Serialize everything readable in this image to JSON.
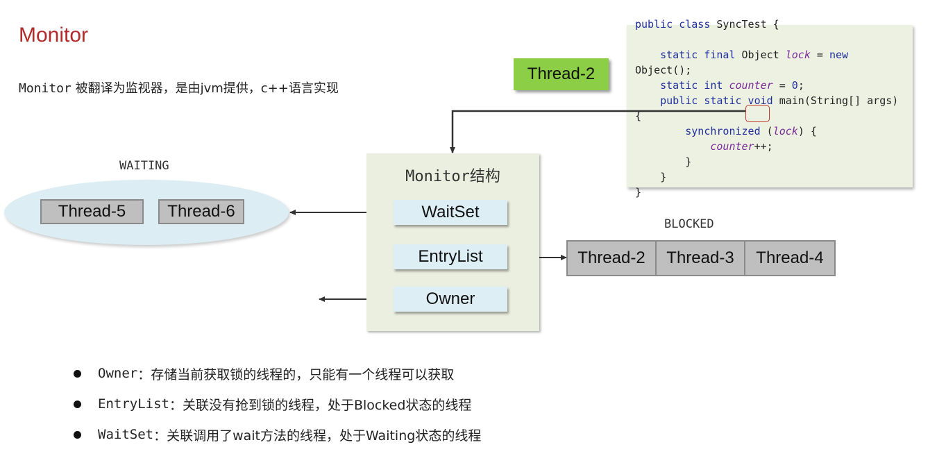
{
  "title": "Monitor",
  "subtitle": {
    "code": "Monitor",
    "text": " 被翻译为监视器，是由jvm提供，c++语言实现"
  },
  "thread_tag": "Thread-2",
  "code": {
    "line1_a": "public class",
    "line1_b": " SyncTest {",
    "line3_kw1": "static final",
    "line3_obj": " Object ",
    "line3_var": "lock",
    "line3_eq": " = ",
    "line3_new": "new",
    "line4": "Object();",
    "line5_kw": "static int",
    "line5_var": "counter",
    "line5_eq": " = ",
    "line5_num": "0",
    "line5_end": ";",
    "line6_kw": "public static void",
    "line6_rest": " main(String[] args)",
    "line7": "{",
    "line8_kw": "synchronized",
    "line8_open": " (",
    "line8_var": "lock",
    "line8_close": ") {",
    "line9_var": "counter",
    "line9_end": "++;",
    "line10": "}",
    "line11": "}",
    "line12": "}"
  },
  "monitor": {
    "title_en": "Monitor",
    "title_cn": "结构",
    "waitset": "WaitSet",
    "entrylist": "EntryList",
    "owner": "Owner"
  },
  "waiting": {
    "label": "WAITING",
    "threads": [
      "Thread-5",
      "Thread-6"
    ]
  },
  "blocked": {
    "label": "BLOCKED",
    "threads": [
      "Thread-2",
      "Thread-3",
      "Thread-4"
    ]
  },
  "bullets": [
    {
      "code": "Owner",
      "text": "：存储当前获取锁的线程的，只能有一个线程可以获取"
    },
    {
      "code": "EntryList",
      "text": "：关联没有抢到锁的线程，处于Blocked状态的线程"
    },
    {
      "code": "WaitSet",
      "text": "：关联调用了wait方法的线程，处于Waiting状态的线程"
    }
  ]
}
